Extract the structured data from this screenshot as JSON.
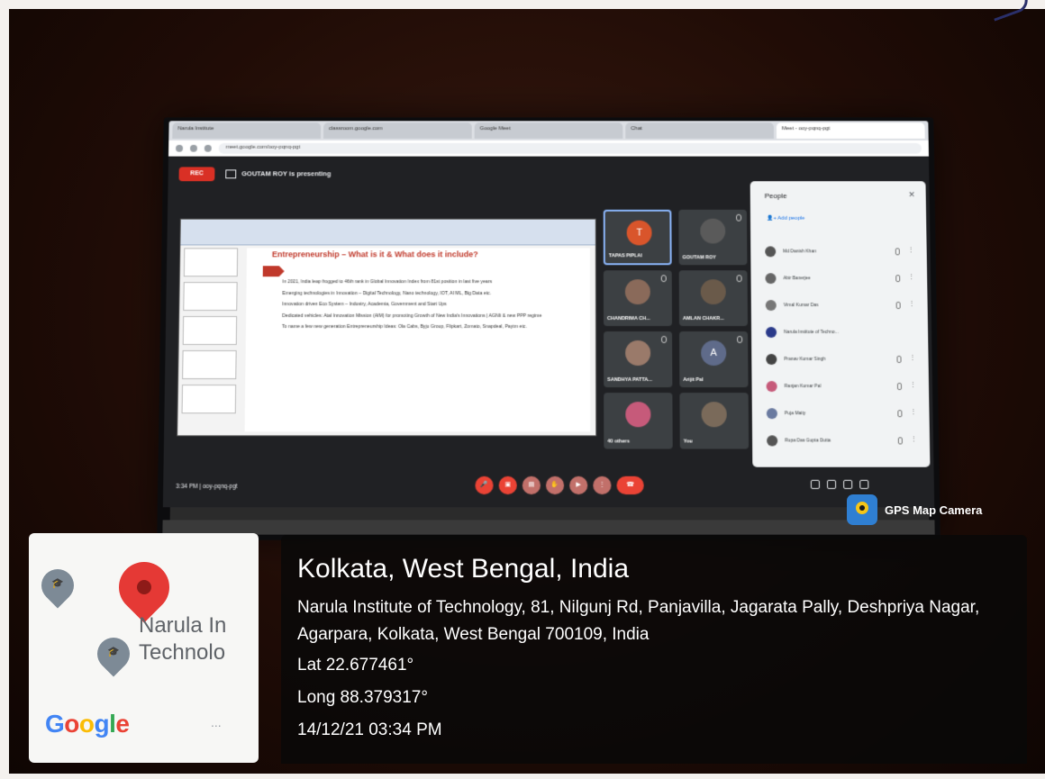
{
  "browser": {
    "tabs": [
      "Narula Institute",
      "classroom.google.com",
      "Google Meet",
      "Chat",
      "Meet - ooy-pqnq-pgt"
    ],
    "url": "meet.google.com/ooy-pqnq-pgt"
  },
  "meet": {
    "rec_label": "REC",
    "presenting_text": "GOUTAM ROY is presenting",
    "clock": "3:34 PM  |  ooy-pqnq-pgt",
    "slide": {
      "heading": "Entrepreneurship – What is it & What does it include?",
      "bullets": [
        "In 2021, India leap frogged to 46th rank in Global Innovation Index from 81st position in last five years",
        "Emerging technologies in Innovation – Digital Technology, Nano technology, IOT, AI ML, Big Data etc.",
        "Innovation driven Eco System – Industry, Academia, Government and Start Ups",
        "Dedicated vehicles: Atal Innovation Mission (AIM) for promoting Growth of New India's Innovations | AGNIi & new PPP regime",
        "To name a few new generation Entrepreneurship Ideas: Ola Cabs, Byju Group, Flipkart, Zomato, Snapdeal, Paytm etc."
      ]
    },
    "tiles": [
      {
        "name": "TAPAS PIPLAI",
        "initial": "T",
        "color": "#d9552b"
      },
      {
        "name": "GOUTAM ROY",
        "initial": "",
        "color": "#5a5a5a"
      },
      {
        "name": "CHANDRIMA CH...",
        "initial": "",
        "color": "#8a6a5a"
      },
      {
        "name": "AMLAN CHAKR...",
        "initial": "",
        "color": "#6a5a4a"
      },
      {
        "name": "SANDHYA PATTA...",
        "initial": "",
        "color": "#9a7a6a"
      },
      {
        "name": "Arijit Pal",
        "initial": "A",
        "color": "#5f6b8a"
      },
      {
        "name": "40 others",
        "initial": "",
        "color": "#c65a7a"
      },
      {
        "name": "You",
        "initial": "",
        "color": "#7a6a5a"
      }
    ],
    "people_panel": {
      "title": "People",
      "add_label": "Add people",
      "people": [
        "Md Danish Khan",
        "Abir Banerjee",
        "Vimal Kumar Das",
        "Narula Institute of Techno...",
        "Pranav Kumar Singh",
        "Ranjan Kumar Pal",
        "Puja Maity",
        "Rupa Das Gupta Dutta"
      ]
    }
  },
  "overlay": {
    "gps_label": "GPS Map Camera",
    "map_place": "Narula In\nTechnolo",
    "map_more": "...",
    "city": "Kolkata, West Bengal, India",
    "address": "Narula Institute of Technology, 81, Nilgunj Rd, Panjavilla, Jagarata Pally, Deshpriya Nagar, Agarpara, Kolkata, West Bengal 700109, India",
    "lat": "Lat 22.677461°",
    "long": "Long 88.379317°",
    "datetime": "14/12/21 03:34 PM"
  }
}
